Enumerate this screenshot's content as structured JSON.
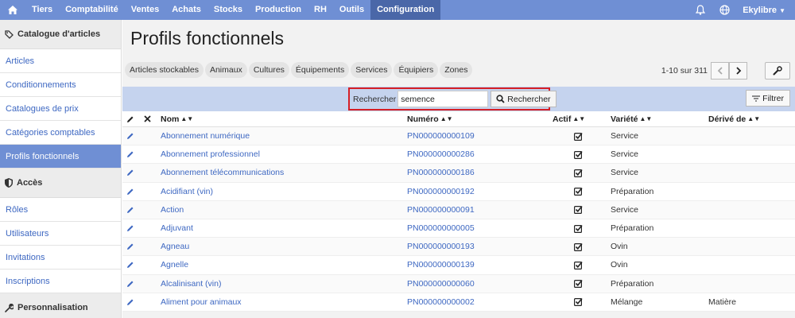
{
  "topnav": {
    "items": [
      "Tiers",
      "Comptabilité",
      "Ventes",
      "Achats",
      "Stocks",
      "Production",
      "RH",
      "Outils",
      "Configuration"
    ],
    "active_index": 8,
    "user": "Ekylibre",
    "icons": [
      "home-icon",
      "bell-icon",
      "globe-icon"
    ]
  },
  "sidebar": {
    "group1": "Catalogue d'articles",
    "group1_items": [
      "Articles",
      "Conditionnements",
      "Catalogues de prix",
      "Catégories comptables",
      "Profils fonctionnels"
    ],
    "group2": "Accès",
    "group2_items": [
      "Rôles",
      "Utilisateurs",
      "Invitations",
      "Inscriptions"
    ],
    "group3": "Personnalisation"
  },
  "main": {
    "title": "Profils fonctionnels",
    "tabs": [
      "Articles stockables",
      "Animaux",
      "Cultures",
      "Équipements",
      "Services",
      "Équipiers",
      "Zones"
    ],
    "pager": "1-10 sur 311",
    "search": {
      "label": "Rechercher",
      "value": "semence",
      "button": "Rechercher"
    },
    "filter_button": "Filtrer"
  },
  "table": {
    "headers": {
      "name": "Nom",
      "number": "Numéro",
      "active": "Actif",
      "variety": "Variété",
      "derived": "Dérivé de"
    },
    "rows": [
      {
        "name": "Abonnement numérique",
        "number": "PN000000000109",
        "variety": "Service",
        "derived": ""
      },
      {
        "name": "Abonnement professionnel",
        "number": "PN000000000286",
        "variety": "Service",
        "derived": ""
      },
      {
        "name": "Abonnement télécommunications",
        "number": "PN000000000186",
        "variety": "Service",
        "derived": ""
      },
      {
        "name": "Acidifiant (vin)",
        "number": "PN000000000192",
        "variety": "Préparation",
        "derived": ""
      },
      {
        "name": "Action",
        "number": "PN000000000091",
        "variety": "Service",
        "derived": ""
      },
      {
        "name": "Adjuvant",
        "number": "PN000000000005",
        "variety": "Préparation",
        "derived": ""
      },
      {
        "name": "Agneau",
        "number": "PN000000000193",
        "variety": "Ovin",
        "derived": ""
      },
      {
        "name": "Agnelle",
        "number": "PN000000000139",
        "variety": "Ovin",
        "derived": ""
      },
      {
        "name": "Alcalinisant (vin)",
        "number": "PN000000000060",
        "variety": "Préparation",
        "derived": ""
      },
      {
        "name": "Aliment pour animaux",
        "number": "PN000000000002",
        "variety": "Mélange",
        "derived": "Matière"
      }
    ]
  },
  "colors": {
    "nav": "#6f8fd4",
    "nav_active": "#4a67a8",
    "link": "#3e68c2",
    "search_bg": "#c5d3ee",
    "highlight": "#d61f26"
  }
}
